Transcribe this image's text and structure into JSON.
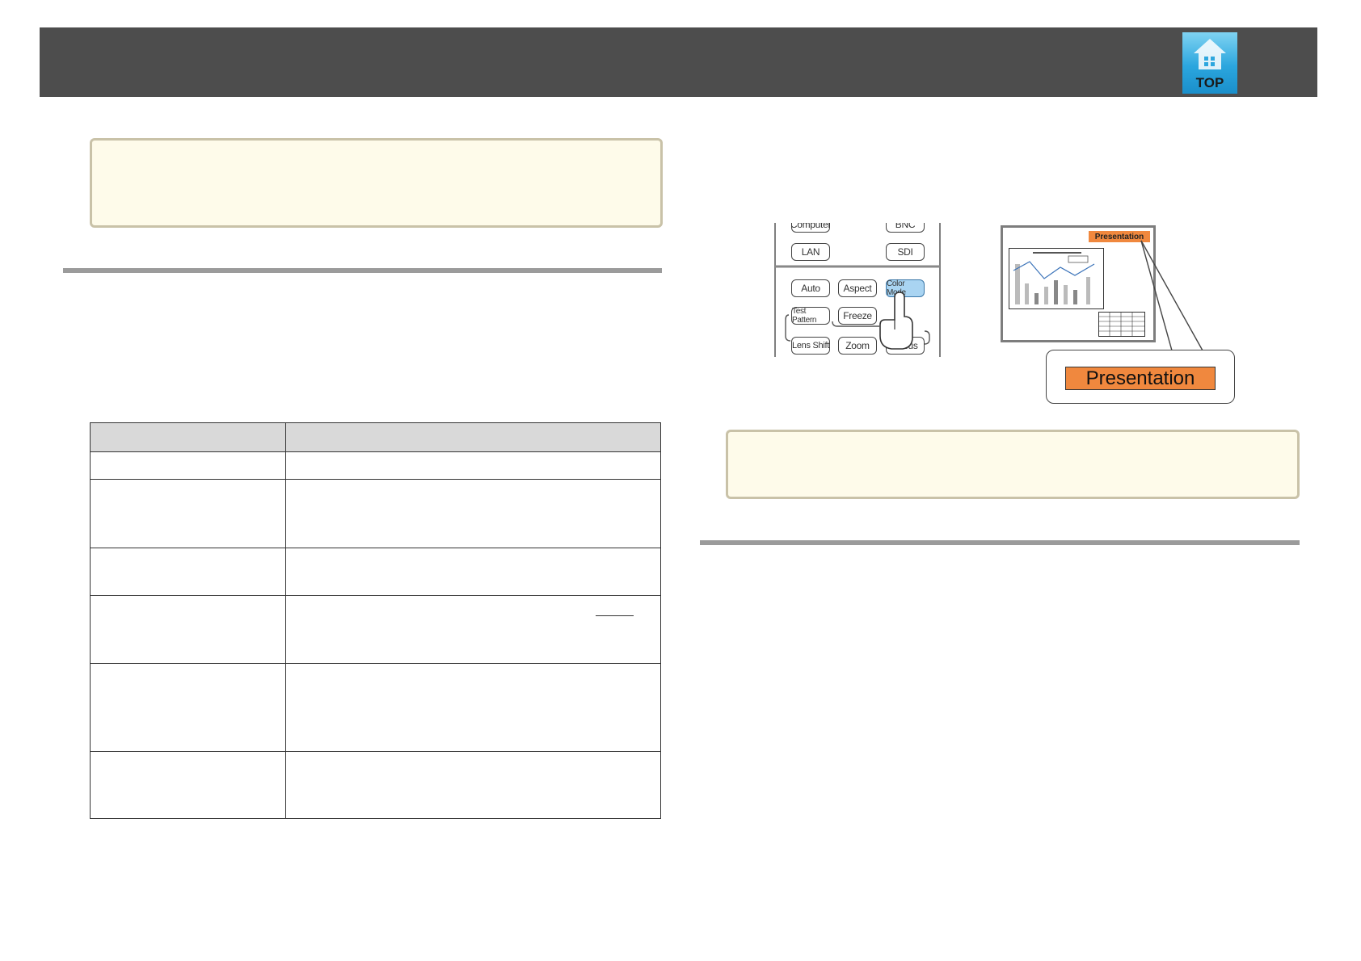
{
  "header": {
    "top_icon_label": "TOP",
    "top_icon_name": "top-home-icon"
  },
  "colors": {
    "header_bar": "#4d4d4d",
    "note_background": "#fefbea",
    "note_border": "#c9c2a8",
    "section_rule": "#9b9b9b",
    "table_header": "#d9d9d9",
    "highlight_button": "#a9d4f2",
    "mode_label": "#f0883e"
  },
  "table": {
    "rows": 6
  },
  "figure": {
    "remote_buttons": {
      "computer": "Computer",
      "bnc": "BNC",
      "lan": "LAN",
      "sdi": "SDI",
      "auto": "Auto",
      "aspect": "Aspect",
      "color_mode": "Color Mode",
      "test_pattern": "Test Pattern",
      "freeze": "Freeze",
      "lens_shift": "Lens Shift",
      "zoom": "Zoom",
      "focus": "Focus"
    },
    "screen_mode_label": "Presentation",
    "callout_mode_label": "Presentation"
  }
}
